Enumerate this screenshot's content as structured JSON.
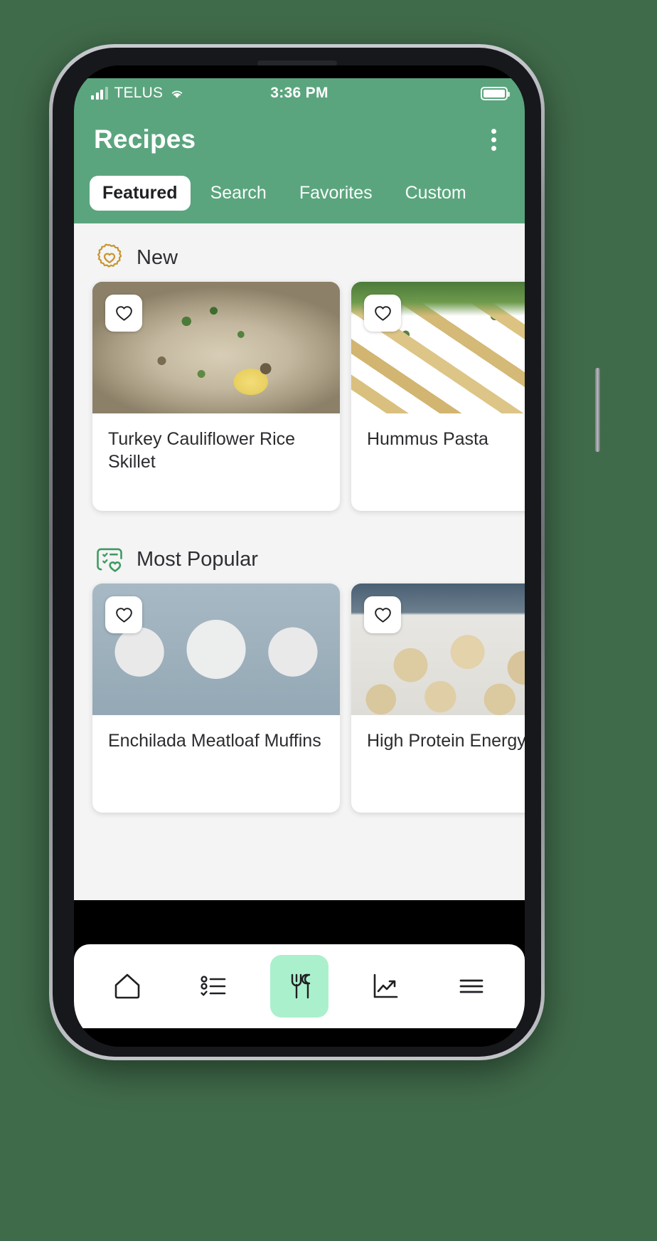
{
  "colors": {
    "brand_green": "#5ba57e",
    "page_bg": "#f4f4f4",
    "active_nav": "#aaf0cc",
    "badge_gold": "#c8952e",
    "badge_green": "#3f9b63",
    "frame_backdrop": "#406b4a"
  },
  "status_bar": {
    "carrier": "TELUS",
    "time": "3:36 PM",
    "signal_icon": "signal-bars-icon",
    "wifi_icon": "wifi-icon",
    "battery_icon": "battery-full-icon"
  },
  "appbar": {
    "title": "Recipes",
    "overflow_icon": "kebab-menu-icon"
  },
  "tabs": [
    {
      "label": "Featured",
      "active": true
    },
    {
      "label": "Search",
      "active": false
    },
    {
      "label": "Favorites",
      "active": false
    },
    {
      "label": "Custom",
      "active": false
    }
  ],
  "sections": [
    {
      "title": "New",
      "icon": "award-heart-badge-icon",
      "icon_color": "#c8952e",
      "cards": [
        {
          "title": "Turkey Cauliflower Rice Skillet",
          "favorite_icon": "heart-outline-icon",
          "favorited": false
        },
        {
          "title": "Hummus Pasta",
          "favorite_icon": "heart-outline-icon",
          "favorited": false
        }
      ]
    },
    {
      "title": "Most Popular",
      "icon": "checklist-heart-icon",
      "icon_color": "#3f9b63",
      "cards": [
        {
          "title": "Enchilada Meatloaf Muffins",
          "favorite_icon": "heart-outline-icon",
          "favorited": false
        },
        {
          "title": "High Protein Energy Bites",
          "favorite_icon": "heart-outline-icon",
          "favorited": false
        }
      ]
    }
  ],
  "bottom_nav": [
    {
      "icon": "home-icon",
      "active": false
    },
    {
      "icon": "checklist-icon",
      "active": false
    },
    {
      "icon": "fork-knife-icon",
      "active": true
    },
    {
      "icon": "trending-chart-icon",
      "active": false
    },
    {
      "icon": "hamburger-menu-icon",
      "active": false
    }
  ]
}
